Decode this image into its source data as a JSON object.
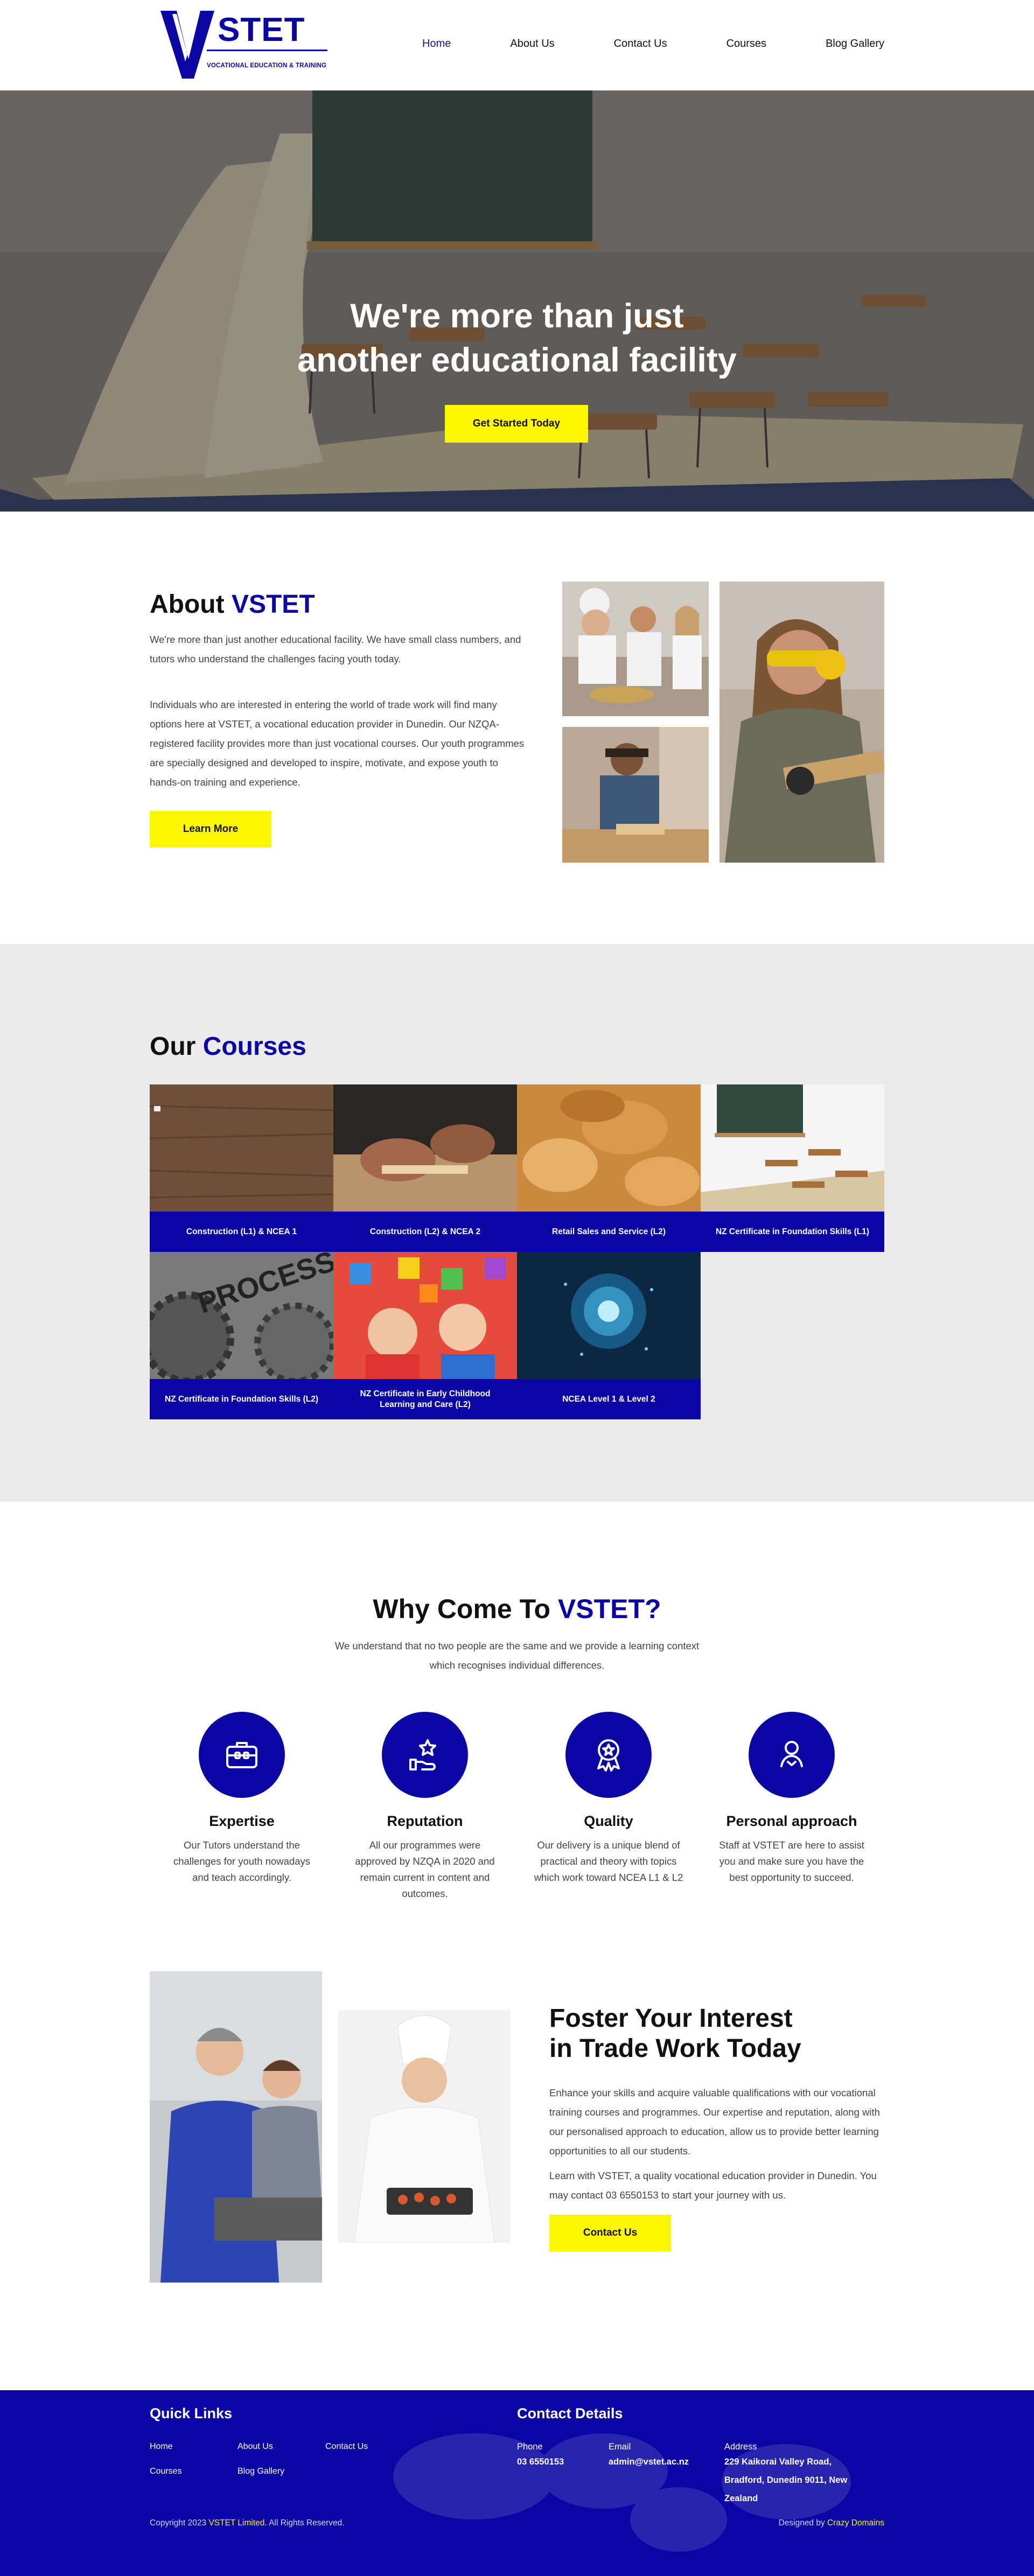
{
  "brand": {
    "logo_letter": "V",
    "name": "STET",
    "tagline": "VOCATIONAL EDUCATION & TRAINING",
    "primary_color": "#0b05a3",
    "accent_color": "#fdf700"
  },
  "nav": {
    "items": [
      {
        "label": "Home",
        "active": true
      },
      {
        "label": "About Us"
      },
      {
        "label": "Contact Us"
      },
      {
        "label": "Courses"
      },
      {
        "label": "Blog Gallery"
      }
    ]
  },
  "hero": {
    "title_line1": "We're more than just",
    "title_line2": "another educational facility",
    "button": "Get Started Today"
  },
  "about": {
    "title": "About",
    "title_accent": "VSTET",
    "para1": "We're more than just another educational facility. We have small class numbers, and tutors who understand the challenges facing youth today.",
    "para2": "Individuals who are interested in entering the world of trade work will find many options here at VSTET, a vocational education provider in Dunedin. Our NZQA-registered facility provides more than just vocational courses. Our youth programmes are specially designed and developed to inspire, motivate, and expose youth to hands-on training and experience.",
    "button": "Learn More"
  },
  "courses": {
    "title": "Our",
    "title_accent": "Courses",
    "items": [
      {
        "label": "Construction (L1) & NCEA 1"
      },
      {
        "label": "Construction (L2) & NCEA 2"
      },
      {
        "label": "Retail Sales and Service (L2)"
      },
      {
        "label": "NZ Certificate in Foundation Skills (L1)"
      },
      {
        "label": "NZ Certificate in Foundation Skills (L2)"
      },
      {
        "label": "NZ Certificate in Early Childhood Learning and Care (L2)"
      },
      {
        "label": "NCEA Level 1 & Level 2"
      }
    ]
  },
  "why": {
    "title": "Why Come To",
    "title_accent": "VSTET?",
    "intro": "We understand that no two people are the same and we provide a learning context which recognises individual differences.",
    "features": [
      {
        "icon": "briefcase-icon",
        "title": "Expertise",
        "text": "Our Tutors understand the challenges for youth nowadays and teach accordingly."
      },
      {
        "icon": "hand-star-icon",
        "title": "Reputation",
        "text": "All our programmes were approved by NZQA in 2020 and remain current in content and outcomes."
      },
      {
        "icon": "award-ribbon-icon",
        "title": "Quality",
        "text": "Our delivery is a unique blend of practical and theory with topics which work toward NCEA L1 & L2"
      },
      {
        "icon": "person-support-icon",
        "title": "Personal approach",
        "text": "Staff at VSTET are here to assist you and make sure you have the best opportunity to succeed."
      }
    ]
  },
  "foster": {
    "title_line1": "Foster Your Interest",
    "title_line2": "in Trade Work Today",
    "para1": "Enhance your skills and acquire valuable qualifications with our vocational training courses and programmes. Our expertise and reputation, along with our personalised approach to education, allow us to provide better learning opportunities to all our students.",
    "para2": "Learn with VSTET, a quality vocational education provider in Dunedin. You may contact 03 6550153 to start your journey with us.",
    "button": "Contact Us"
  },
  "footer": {
    "quick_links_title": "Quick Links",
    "links": [
      "Home",
      "About Us",
      "Contact Us",
      "Courses",
      "Blog Gallery"
    ],
    "contact_title": "Contact Details",
    "phone_label": "Phone",
    "phone": "03 6550153",
    "email_label": "Email",
    "email": "admin@vstet.ac.nz",
    "address_label": "Address",
    "address": "229 Kaikorai Valley Road, Bradford, Dunedin 9011, New Zealand",
    "copyright_pre": "Copyright 2023",
    "copyright_brand": "VSTET Limited.",
    "copyright_post": "All Rights Reserved.",
    "designed_pre": "Designed by",
    "designed_brand": "Crazy Domains"
  }
}
